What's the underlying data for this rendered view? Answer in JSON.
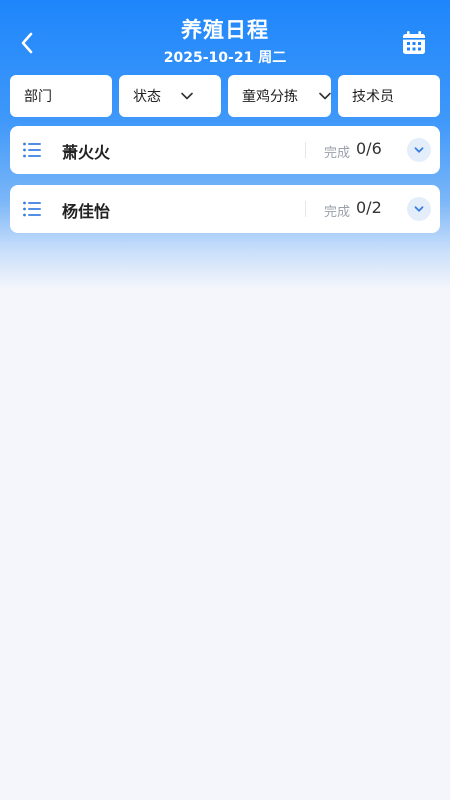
{
  "header": {
    "title": "养殖日程",
    "date": "2025-10-21 周二",
    "back_icon": "back-arrow-icon",
    "calendar_icon": "calendar-icon"
  },
  "filters": {
    "department": "部门",
    "status": "状态",
    "category": "童鸡分拣",
    "technician": "技术员"
  },
  "people": [
    {
      "name": "萧火火",
      "done_label": "完成",
      "progress": "0/6"
    },
    {
      "name": "杨佳怡",
      "done_label": "完成",
      "progress": "0/2"
    }
  ],
  "colors": {
    "primary": "#1e86fb",
    "accent_blue": "#3a7fe0",
    "background": "#f5f6fb"
  }
}
